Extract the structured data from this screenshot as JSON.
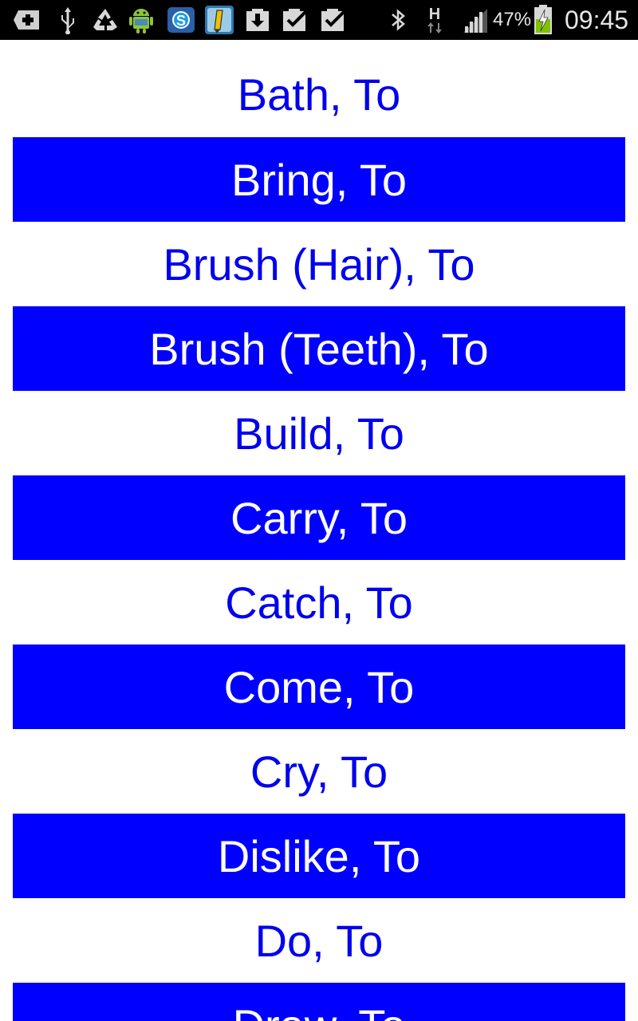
{
  "status_bar": {
    "left_icons": [
      "add-icon",
      "usb-icon",
      "recycle-icon",
      "android-icon",
      "skype-icon",
      "pen-icon",
      "download-icon",
      "check-icon",
      "check-icon"
    ],
    "bluetooth_icon": "bluetooth-icon",
    "network_type": "H",
    "signal_icon": "signal-bars-icon",
    "battery_percent": "47%",
    "battery_icon": "battery-charging-icon",
    "time": "09:45"
  },
  "list": {
    "items": [
      {
        "label": "Bath, To"
      },
      {
        "label": "Bring, To"
      },
      {
        "label": "Brush (Hair), To"
      },
      {
        "label": "Brush (Teeth), To"
      },
      {
        "label": "Build, To"
      },
      {
        "label": "Carry, To"
      },
      {
        "label": "Catch, To"
      },
      {
        "label": "Come, To"
      },
      {
        "label": "Cry, To"
      },
      {
        "label": "Dislike, To"
      },
      {
        "label": "Do, To"
      },
      {
        "label": "Draw, To"
      }
    ]
  },
  "colors": {
    "highlight_bg": "#0000ff",
    "highlight_text": "#ffffff",
    "normal_text": "#0000ee",
    "status_bg": "#000000"
  }
}
